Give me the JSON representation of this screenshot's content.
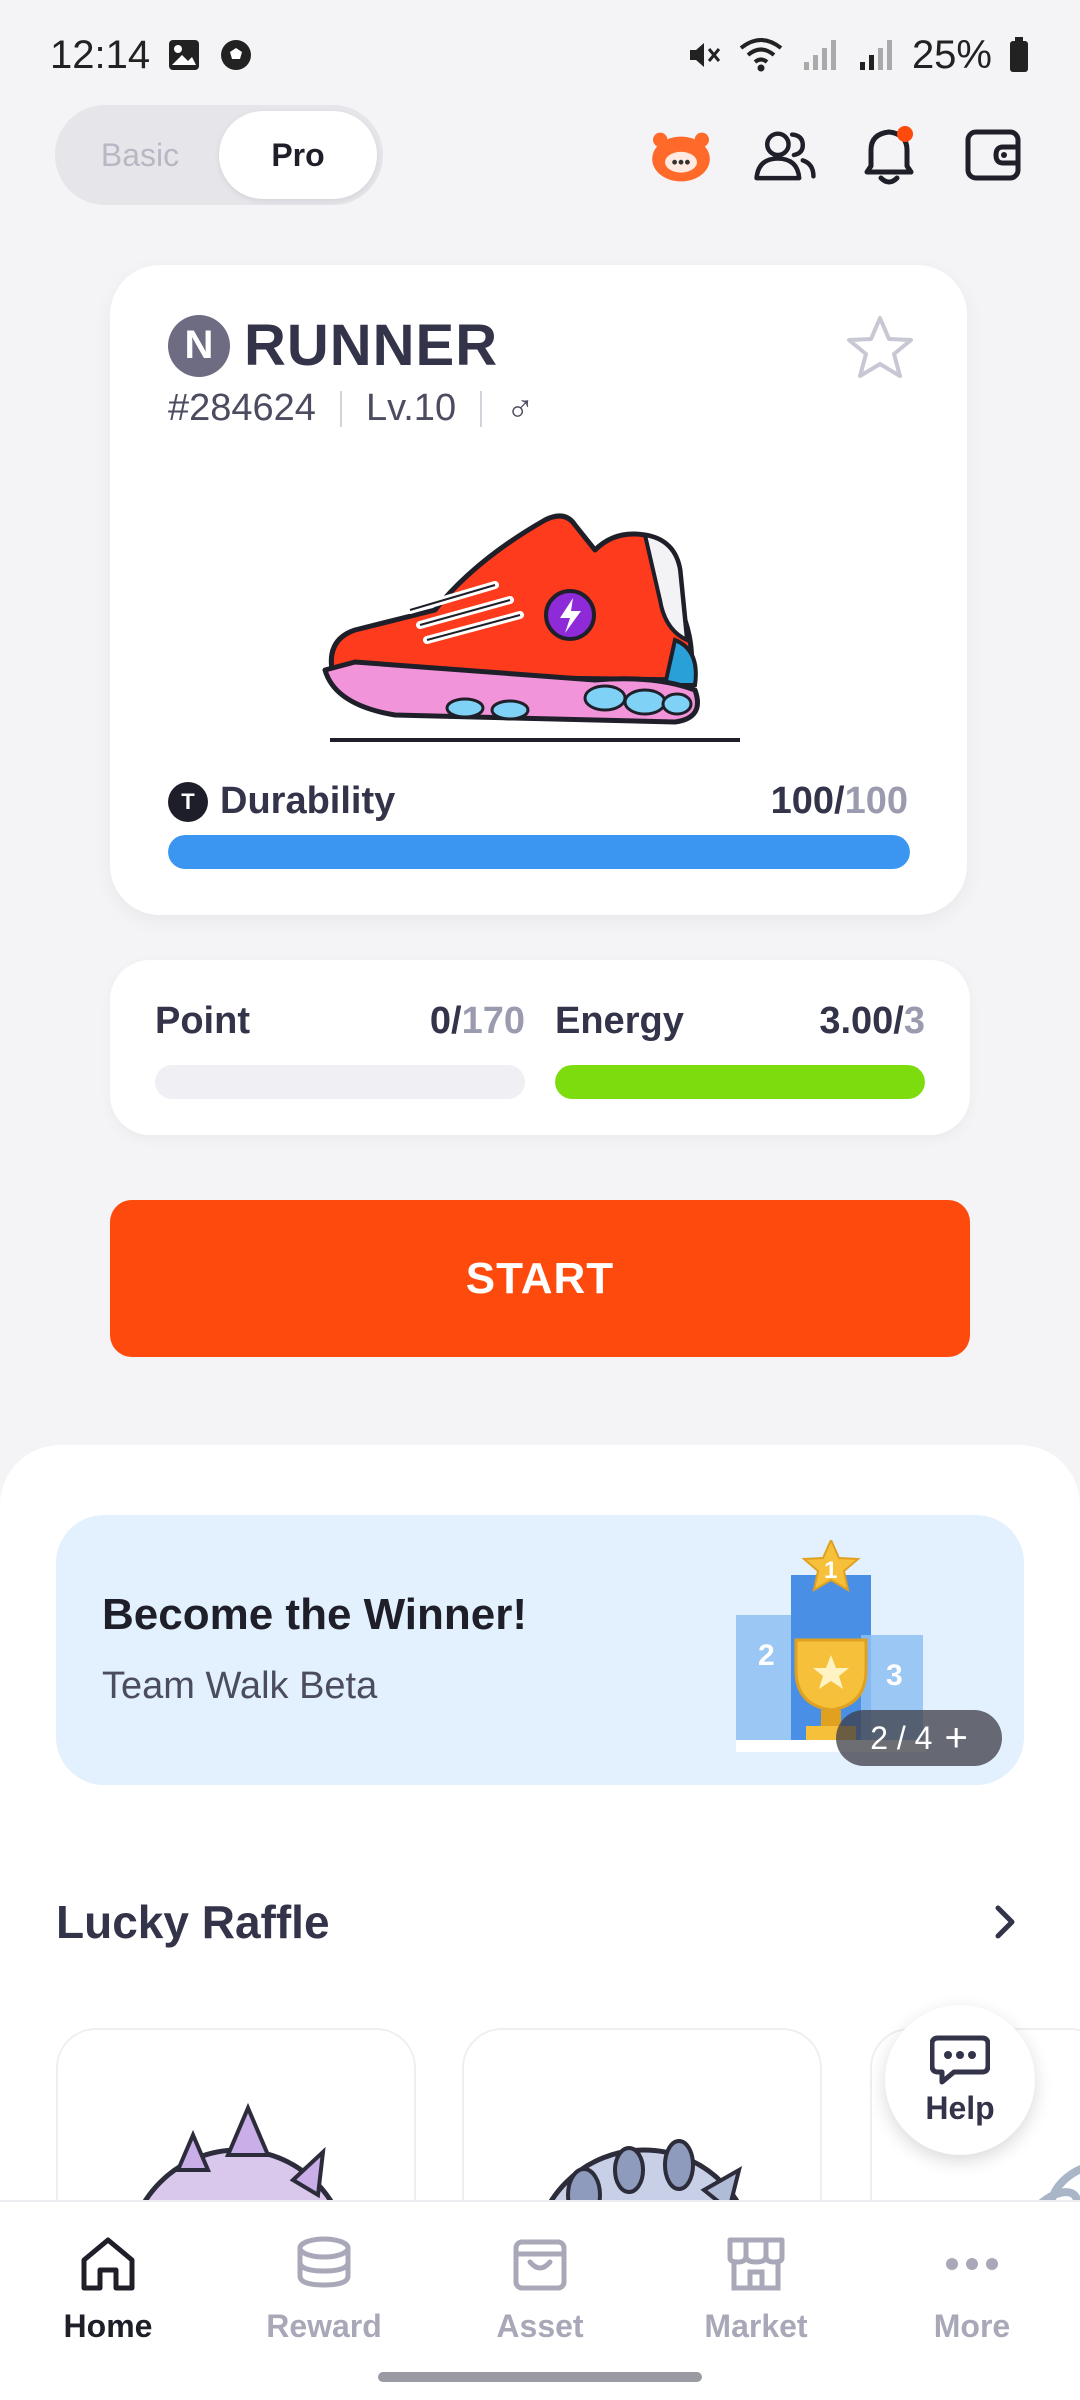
{
  "status_bar": {
    "time": "12:14",
    "battery": "25%"
  },
  "mode_toggle": {
    "basic_label": "Basic",
    "pro_label": "Pro",
    "selected": "Pro"
  },
  "runner": {
    "grade": "N",
    "name": "RUNNER",
    "id": "#284624",
    "level": "Lv.10",
    "gender_symbol": "♂",
    "durability_label": "Durability",
    "durability_value": "100",
    "durability_max": "100",
    "durability_fraction": 1.0
  },
  "stats": {
    "point_label": "Point",
    "point_value": "0",
    "point_max": "170",
    "point_fraction": 0,
    "energy_label": "Energy",
    "energy_value": "3.00",
    "energy_max": "3",
    "energy_fraction": 1.0
  },
  "start_label": "START",
  "banner": {
    "title": "Become the Winner!",
    "subtitle": "Team Walk Beta",
    "rank_first": "1",
    "rank_second": "2",
    "rank_third": "3",
    "pager": "2 / 4",
    "pager_plus": "+"
  },
  "raffle": {
    "title": "Lucky Raffle"
  },
  "help_label": "Help",
  "nav": [
    {
      "label": "Home",
      "icon": "home-icon",
      "active": true
    },
    {
      "label": "Reward",
      "icon": "coins-icon",
      "active": false
    },
    {
      "label": "Asset",
      "icon": "bag-icon",
      "active": false
    },
    {
      "label": "Market",
      "icon": "store-icon",
      "active": false
    },
    {
      "label": "More",
      "icon": "more-icon",
      "active": false
    }
  ],
  "colors": {
    "accent": "#ff4a0e",
    "durability_bar": "#3a96f0",
    "energy_bar": "#7ddc0e",
    "banner_bg": "#e3f0fd"
  }
}
